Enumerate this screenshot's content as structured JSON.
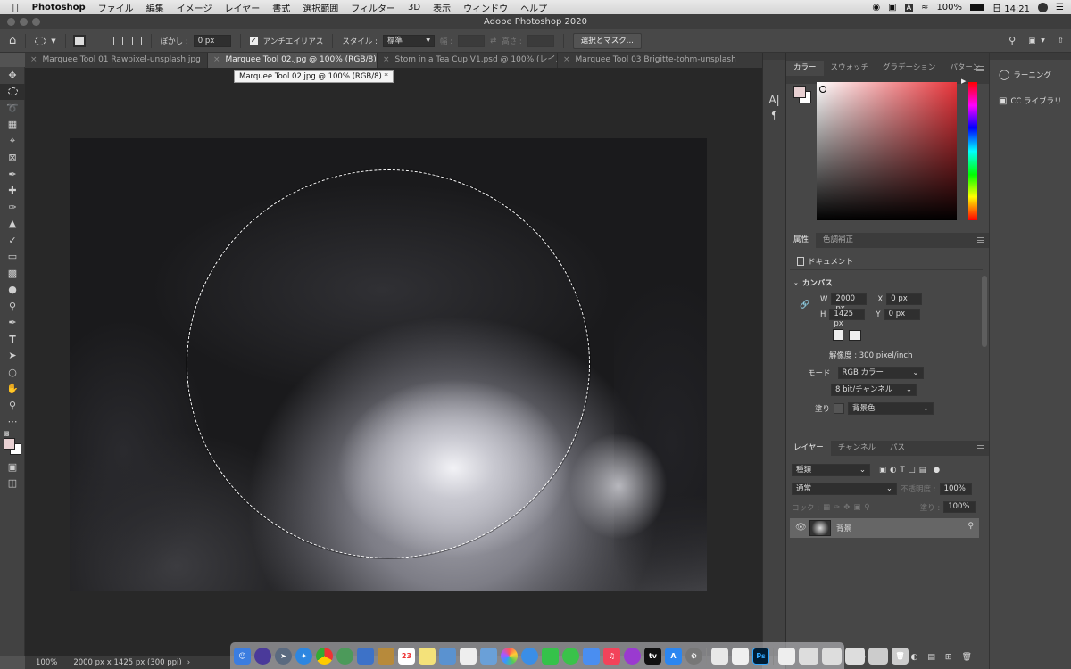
{
  "menubar": {
    "app_name": "Photoshop",
    "items": [
      "ファイル",
      "編集",
      "イメージ",
      "レイヤー",
      "書式",
      "選択範囲",
      "フィルター",
      "3D",
      "表示",
      "ウィンドウ",
      "ヘルプ"
    ],
    "battery": "100%",
    "time": "日 14:21"
  },
  "window": {
    "title": "Adobe Photoshop 2020"
  },
  "options": {
    "feather_label": "ぼかし :",
    "feather_value": "0 px",
    "antialias_label": "アンチエイリアス",
    "style_label": "スタイル :",
    "style_value": "標準",
    "width_label": "幅 :",
    "height_label": "高さ :",
    "select_mask_button": "選択とマスク..."
  },
  "tabs": [
    {
      "label": "Marquee Tool 01 Rawpixel-unsplash.jpg"
    },
    {
      "label": "Marquee Tool 02.jpg @ 100% (RGB/8) *"
    },
    {
      "label": "Stom in a Tea Cup V1.psd @ 100% (レイ..."
    },
    {
      "label": "Marquee Tool 03 Brigitte-tohm-unsplash.jpg"
    }
  ],
  "tooltip": "Marquee Tool 02.jpg @ 100% (RGB/8) *",
  "status": {
    "zoom": "100%",
    "doc_info": "2000 px x 1425 px (300 ppi)"
  },
  "color_panel": {
    "tabs": [
      "カラー",
      "スウォッチ",
      "グラデーション",
      "パターン"
    ]
  },
  "properties_panel": {
    "tabs": [
      "属性",
      "色調補正"
    ],
    "doc_label": "ドキュメント",
    "canvas_section": "カンバス",
    "w_label": "W",
    "w_value": "2000 px",
    "h_label": "H",
    "h_value": "1425 px",
    "x_label": "X",
    "x_placeholder": "0 px",
    "y_label": "Y",
    "y_placeholder": "0 px",
    "resolution": "解像度 : 300 pixel/inch",
    "mode_label": "モード",
    "mode_value": "RGB カラー",
    "bit_value": "8 bit/チャンネル",
    "fill_label": "塗り",
    "fill_value": "背景色"
  },
  "layers_panel": {
    "tabs": [
      "レイヤー",
      "チャンネル",
      "パス"
    ],
    "kind_filter": "種類",
    "blend_mode": "通常",
    "opacity_label": "不透明度 :",
    "opacity_value": "100%",
    "lock_label": "ロック :",
    "fill_label": "塗り :",
    "fill_value": "100%",
    "layers": [
      {
        "name": "背景"
      }
    ]
  },
  "right_panel": {
    "learn": "ラーニング",
    "libraries": "CC ライブラリ"
  },
  "dock": {
    "calendar_day": "23"
  },
  "colors": {
    "accent_red": "#e8343a",
    "selection": "#ffffff",
    "foreground_swatch": "#e8d0d2"
  }
}
